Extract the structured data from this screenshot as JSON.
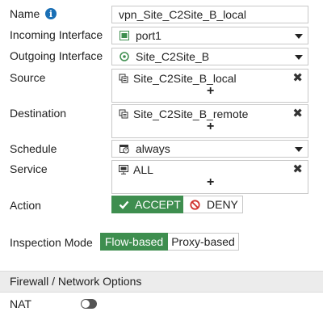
{
  "form": {
    "name_label": "Name",
    "name_value": "vpn_Site_C2Site_B_local",
    "incoming_label": "Incoming Interface",
    "incoming_value": "port1",
    "outgoing_label": "Outgoing Interface",
    "outgoing_value": "Site_C2Site_B",
    "source_label": "Source",
    "source_value": "Site_C2Site_B_local",
    "destination_label": "Destination",
    "destination_value": "Site_C2Site_B_remote",
    "schedule_label": "Schedule",
    "schedule_value": "always",
    "service_label": "Service",
    "service_value": "ALL",
    "action_label": "Action",
    "action_accept": "ACCEPT",
    "action_deny": "DENY",
    "action_selected": "ACCEPT",
    "inspection_label": "Inspection Mode",
    "inspection_flow": "Flow-based",
    "inspection_proxy": "Proxy-based",
    "inspection_selected": "Flow-based",
    "add_symbol": "+",
    "remove_symbol": "✖"
  },
  "section": {
    "title": "Firewall / Network Options"
  },
  "nat": {
    "label": "NAT",
    "enabled": false
  },
  "colors": {
    "accent_green": "#3e8e4f",
    "info_blue": "#1a6fb5",
    "deny_red": "#d0312d"
  },
  "icons": {
    "name_info": "info-icon",
    "incoming": "port-icon",
    "outgoing": "vpn-tunnel-icon",
    "address": "address-group-icon",
    "schedule": "schedule-icon",
    "service": "service-icon",
    "accept": "check-icon",
    "deny": "block-icon"
  }
}
